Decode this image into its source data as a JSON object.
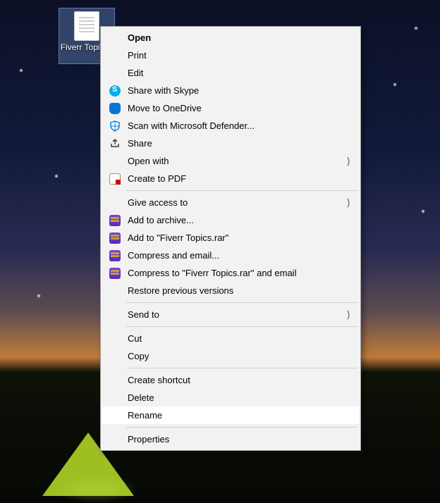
{
  "file": {
    "name": "Fiverr Topics.t"
  },
  "menu": {
    "open": "Open",
    "print": "Print",
    "edit": "Edit",
    "skype": "Share with Skype",
    "onedrive": "Move to OneDrive",
    "defender": "Scan with Microsoft Defender...",
    "share": "Share",
    "openwith": "Open with",
    "pdf": "Create to PDF",
    "giveaccess": "Give access to",
    "addarchive": "Add to archive...",
    "addrar": "Add to \"Fiverr Topics.rar\"",
    "compmail": "Compress and email...",
    "comprarmail": "Compress to \"Fiverr Topics.rar\" and email",
    "restore": "Restore previous versions",
    "sendto": "Send to",
    "cut": "Cut",
    "copy": "Copy",
    "shortcut": "Create shortcut",
    "delete": "Delete",
    "rename": "Rename",
    "properties": "Properties"
  }
}
